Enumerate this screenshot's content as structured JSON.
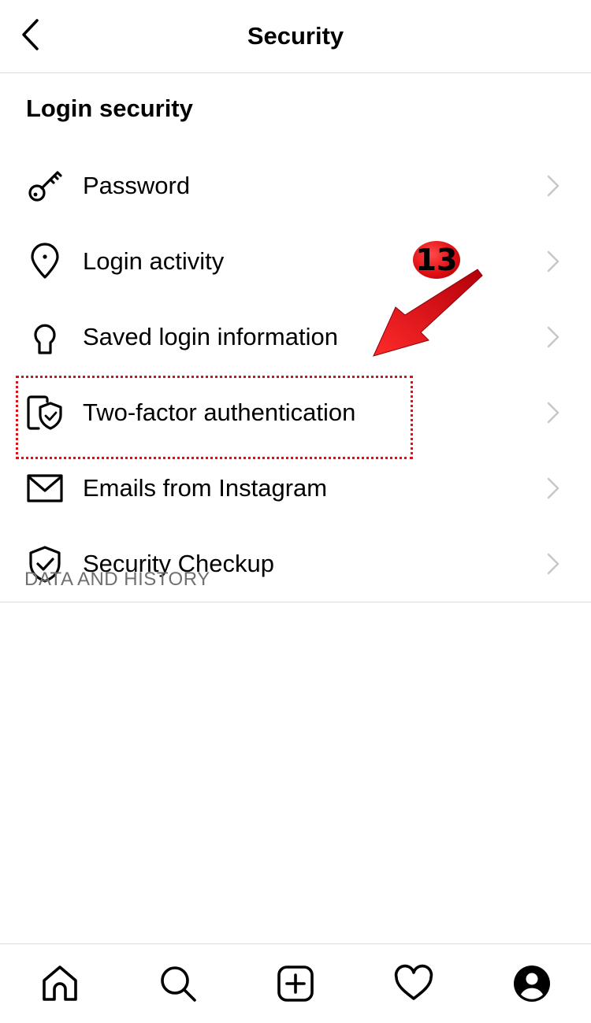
{
  "header": {
    "title": "Security",
    "back_icon": "chevron-left-icon"
  },
  "login_security": {
    "title": "Login security",
    "items": [
      {
        "label": "Password",
        "icon": "key-icon"
      },
      {
        "label": "Login activity",
        "icon": "location-pin-icon"
      },
      {
        "label": "Saved login information",
        "icon": "keyhole-icon"
      },
      {
        "label": "Two-factor authentication",
        "icon": "shield-phone-icon"
      },
      {
        "label": "Emails from Instagram",
        "icon": "envelope-icon"
      },
      {
        "label": "Security Checkup",
        "icon": "shield-check-icon"
      }
    ]
  },
  "data_history": {
    "title": "DATA AND HISTORY"
  },
  "annotation": {
    "number": "13",
    "color": "#d0161c"
  },
  "tabbar": {
    "icons": [
      "home-icon",
      "search-icon",
      "new-post-icon",
      "activity-heart-icon",
      "profile-icon"
    ]
  }
}
